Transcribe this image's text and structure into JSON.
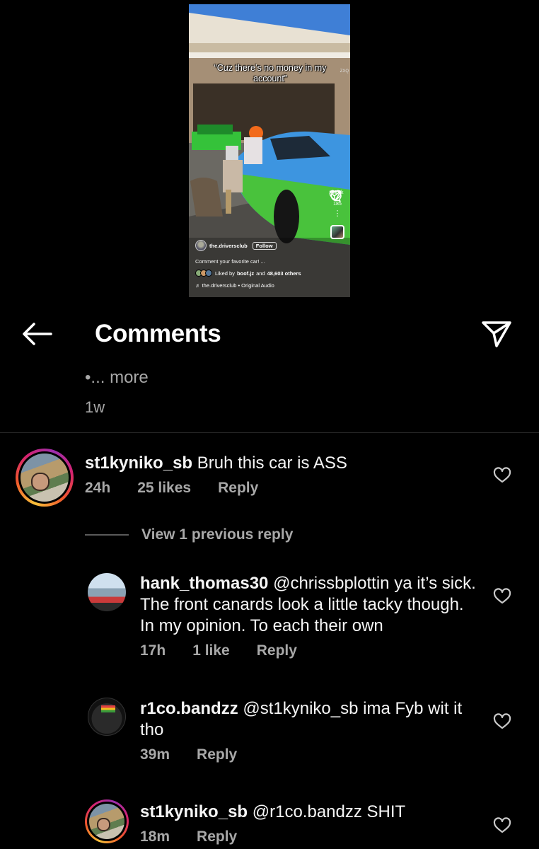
{
  "video": {
    "caption": "“Cuz there’s no money in my account”",
    "like_count": "48.6k",
    "comment_count": "185",
    "username": "the.driversclub",
    "follow_label": "Follow",
    "description": "Comment your favorite car! ...",
    "liked_by_prefix": "Liked by",
    "liked_by_user": "boof.jz",
    "liked_by_mid": "and",
    "liked_by_count": "48,603 others",
    "audio": "the.driversclub • Original Audio",
    "watermark": "ZXQ"
  },
  "header": {
    "title": "Comments"
  },
  "caption_tail": {
    "more": "•... more",
    "age": "1w"
  },
  "comments": [
    {
      "username": "st1kyniko_sb",
      "text": "Bruh this car is ASS",
      "age": "24h",
      "likes": "25 likes",
      "reply": "Reply"
    }
  ],
  "view_replies": "View 1 previous reply",
  "replies": [
    {
      "username": "hank_thomas30",
      "mention": "@chrissbplottin",
      "text_line1": "ya it’s",
      "text_rest": "sick. The front canards look a little tacky though. In my opinion. To each their own",
      "age": "17h",
      "likes": "1 like",
      "reply": "Reply"
    },
    {
      "username": "r1co.bandzz",
      "mention": "@st1kyniko_sb",
      "text": "ima Fyb wit it tho",
      "age": "39m",
      "reply": "Reply"
    },
    {
      "username": "st1kyniko_sb",
      "mention": "@r1co.bandzz",
      "text": "SHIT",
      "age": "18m",
      "reply": "Reply"
    }
  ]
}
